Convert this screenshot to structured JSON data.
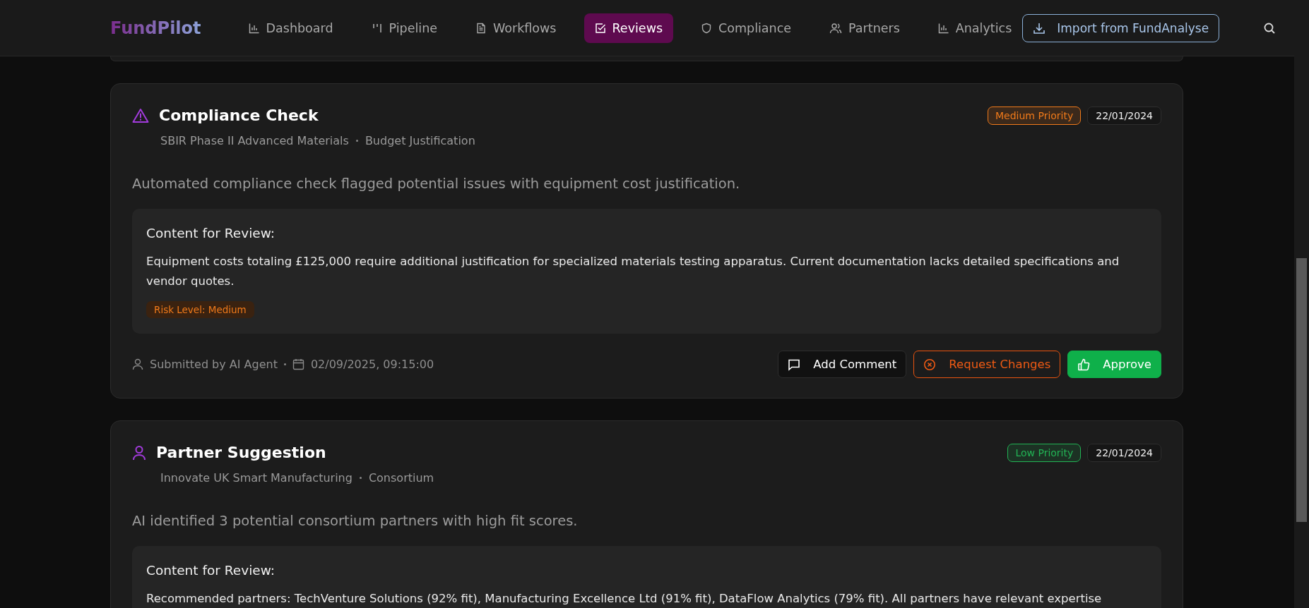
{
  "nav": {
    "logo": "FundPilot",
    "items": [
      {
        "label": "Dashboard",
        "selected": false
      },
      {
        "label": "Pipeline",
        "selected": false
      },
      {
        "label": "Workflows",
        "selected": false
      },
      {
        "label": "Reviews",
        "selected": true
      },
      {
        "label": "Compliance",
        "selected": false
      },
      {
        "label": "Partners",
        "selected": false
      },
      {
        "label": "Analytics",
        "selected": false
      }
    ],
    "import_button": "Import from FundAnalyse"
  },
  "reviews": [
    {
      "kind": "compliance",
      "title": "Compliance Check",
      "program": "SBIR Phase II Advanced Materials",
      "section": "Budget Justification",
      "priority": "Medium Priority",
      "color": "#f07a1a",
      "date": "22/01/2024",
      "description": "Automated compliance check flagged potential issues with equipment cost justification.",
      "content_title": "Content for Review:",
      "content": "Equipment costs totaling £125,000 require additional justification for specialized materials testing apparatus. Current documentation lacks detailed specifications and vendor quotes.",
      "risk": "Risk Level: Medium",
      "submitted_by": "Submitted by AI Agent",
      "submitted_at": "02/09/2025, 09:15:00",
      "actions": [
        "Add Comment",
        "Request Changes",
        "Approve"
      ]
    },
    {
      "kind": "partner",
      "title": "Partner Suggestion",
      "program": "Innovate UK Smart Manufacturing",
      "section": "Consortium",
      "priority": "Low Priority",
      "color": "#22b455",
      "date": "22/01/2024",
      "description": "AI identified 3 potential consortium partners with high fit scores.",
      "content_title": "Content for Review:",
      "content": "Recommended partners: TechVenture Solutions (92% fit), Manufacturing Excellence Ltd (91% fit), DataFlow Analytics (79% fit). All partners have relevant expertise"
    }
  ]
}
